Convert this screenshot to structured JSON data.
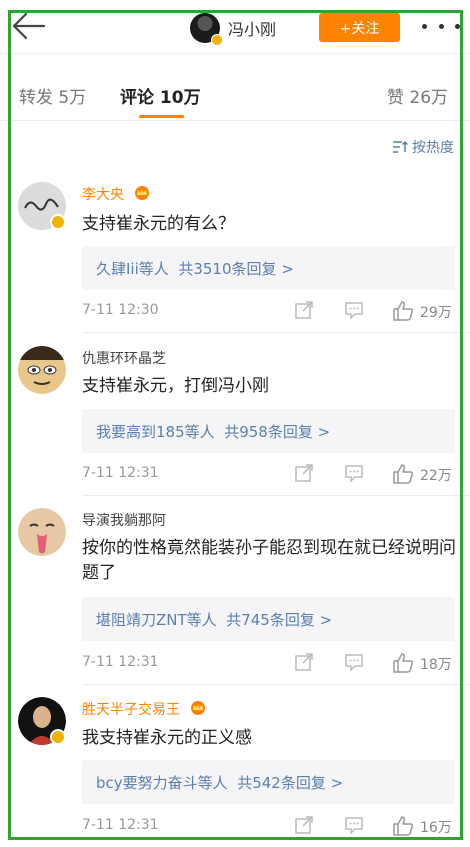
{
  "header": {
    "username": "冯小刚",
    "follow_label": "+关注"
  },
  "tabs": [
    {
      "label": "转发 5万"
    },
    {
      "label": "评论 10万"
    },
    {
      "label": "赞 26万"
    }
  ],
  "sort_label": "按热度",
  "comments": [
    {
      "name": "李大央",
      "text": "支持崔永元的有么？",
      "reply_users": "久肆Iii等人",
      "reply_count": "共3510条回复 >",
      "time": "7-11 12:30",
      "likes": "29万"
    },
    {
      "name": "仇惠环环晶芝",
      "text": "支持崔永元，打倒冯小刚",
      "reply_users": "我要高到185等人",
      "reply_count": "共958条回复 >",
      "time": "7-11 12:31",
      "likes": "22万"
    },
    {
      "name": "导演我躺那阿",
      "text": "按你的性格竟然能装孙子能忍到现在就已经说明问题了",
      "reply_users": "堪阻靖刀ZNT等人",
      "reply_count": "共745条回复 >",
      "time": "7-11 12:31",
      "likes": "18万"
    },
    {
      "name": "胜天半子交易王",
      "text": "我支持崔永元的正义感",
      "reply_users": "bcy要努力奋斗等人",
      "reply_count": "共542条回复 >",
      "time": "7-11 12:31",
      "likes": "16万"
    }
  ],
  "colors": {
    "accent": "#ff8200",
    "link": "#5a7fb0",
    "frame": "#2fa52f"
  }
}
